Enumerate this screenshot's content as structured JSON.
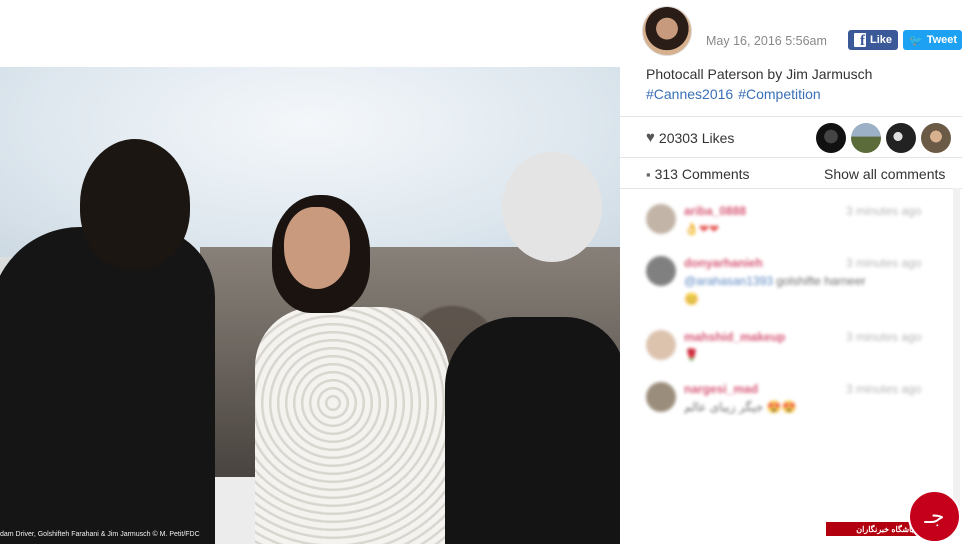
{
  "post": {
    "date": "May 16, 2016 5:56am",
    "caption": "Photocall Paterson by Jim Jarmusch",
    "hashtags": [
      "#Cannes2016",
      "#Competition"
    ],
    "photo_credit": "dam Driver, Golshifteh Farahani  & Jim Jarmusch © M. Petit/FDC"
  },
  "share": {
    "facebook_label": "Like",
    "twitter_label": "Tweet",
    "facebook_icon": "f",
    "twitter_icon": "🐦"
  },
  "stats": {
    "likes_label": "20303 Likes",
    "comments_label": "313 Comments",
    "show_all_label": "Show all comments",
    "heart_icon": "♥",
    "comment_icon": "▪"
  },
  "comments": [
    {
      "user": "ariba_0888",
      "time": "3 minutes ago",
      "text": "",
      "emoji": "👌❤❤"
    },
    {
      "user": "donyarhanieh",
      "time": "3 minutes ago",
      "mention": "@arahasan1393",
      "text": " golshifte harneer",
      "emoji": "😊"
    },
    {
      "user": "mahshid_makeup",
      "time": "3 minutes ago",
      "text": "",
      "emoji": "🌹"
    },
    {
      "user": "nargesi_mad",
      "time": "3 minutes ago",
      "text": "جیگر زیبای عالم ",
      "emoji": "😍😍"
    }
  ],
  "watermark": {
    "label": "باشگاه خبرنگاران",
    "glyph": "جـ"
  },
  "colors": {
    "facebook": "#3b5998",
    "twitter": "#1da1f2",
    "hashtag": "#3b6fb6",
    "username": "#cf3b5d",
    "watermark": "#b3000f"
  }
}
